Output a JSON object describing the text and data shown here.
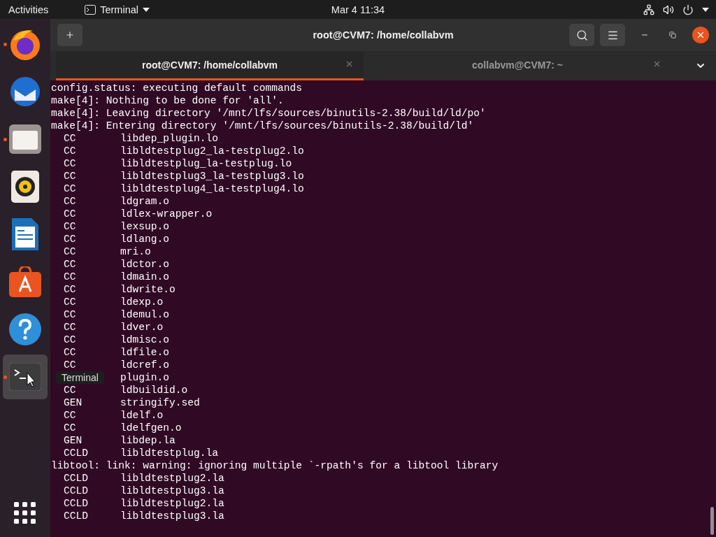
{
  "top_bar": {
    "activities": "Activities",
    "app_menu": "Terminal",
    "clock": "Mar 4  11:34"
  },
  "dock": {
    "items": [
      {
        "kind": "firefox",
        "running": true,
        "selected": false
      },
      {
        "kind": "mail",
        "running": false,
        "selected": false
      },
      {
        "kind": "files",
        "running": true,
        "selected": false
      },
      {
        "kind": "speaker",
        "running": false,
        "selected": false
      },
      {
        "kind": "document",
        "running": false,
        "selected": false
      },
      {
        "kind": "store",
        "running": false,
        "selected": false
      },
      {
        "kind": "help",
        "running": false,
        "selected": false
      },
      {
        "kind": "terminal",
        "running": true,
        "selected": true
      }
    ],
    "tooltip": "Terminal"
  },
  "window": {
    "title": "root@CVM7: /home/collabvm"
  },
  "tabs": [
    {
      "label": "root@CVM7: /home/collabvm",
      "selected": true
    },
    {
      "label": "collabvm@CVM7: ~",
      "selected": false
    }
  ],
  "terminal": {
    "lines": [
      {
        "kind": "plain",
        "text": "config.status: executing default commands"
      },
      {
        "kind": "plain",
        "text": "make[4]: Nothing to be done for 'all'."
      },
      {
        "kind": "plain",
        "text": "make[4]: Leaving directory '/mnt/lfs/sources/binutils-2.38/build/ld/po'"
      },
      {
        "kind": "plain",
        "text": "make[4]: Entering directory '/mnt/lfs/sources/binutils-2.38/build/ld'"
      },
      {
        "kind": "build",
        "tag": "CC",
        "file": "libdep_plugin.lo"
      },
      {
        "kind": "build",
        "tag": "CC",
        "file": "libldtestplug2_la-testplug2.lo"
      },
      {
        "kind": "build",
        "tag": "CC",
        "file": "libldtestplug_la-testplug.lo"
      },
      {
        "kind": "build",
        "tag": "CC",
        "file": "libldtestplug3_la-testplug3.lo"
      },
      {
        "kind": "build",
        "tag": "CC",
        "file": "libldtestplug4_la-testplug4.lo"
      },
      {
        "kind": "build",
        "tag": "CC",
        "file": "ldgram.o"
      },
      {
        "kind": "build",
        "tag": "CC",
        "file": "ldlex-wrapper.o"
      },
      {
        "kind": "build",
        "tag": "CC",
        "file": "lexsup.o"
      },
      {
        "kind": "build",
        "tag": "CC",
        "file": "ldlang.o"
      },
      {
        "kind": "build",
        "tag": "CC",
        "file": "mri.o"
      },
      {
        "kind": "build",
        "tag": "CC",
        "file": "ldctor.o"
      },
      {
        "kind": "build",
        "tag": "CC",
        "file": "ldmain.o"
      },
      {
        "kind": "build",
        "tag": "CC",
        "file": "ldwrite.o"
      },
      {
        "kind": "build",
        "tag": "CC",
        "file": "ldexp.o"
      },
      {
        "kind": "build",
        "tag": "CC",
        "file": "ldemul.o"
      },
      {
        "kind": "build",
        "tag": "CC",
        "file": "ldver.o"
      },
      {
        "kind": "build",
        "tag": "CC",
        "file": "ldmisc.o"
      },
      {
        "kind": "build",
        "tag": "CC",
        "file": "ldfile.o"
      },
      {
        "kind": "build",
        "tag": "CC",
        "file": "ldcref.o"
      },
      {
        "kind": "build",
        "file": "plugin.o"
      },
      {
        "kind": "build",
        "tag": "CC",
        "file": "ldbuildid.o"
      },
      {
        "kind": "build",
        "tag": "GEN",
        "file": "stringify.sed"
      },
      {
        "kind": "build",
        "tag": "CC",
        "file": "ldelf.o"
      },
      {
        "kind": "build",
        "tag": "CC",
        "file": "ldelfgen.o"
      },
      {
        "kind": "build",
        "tag": "GEN",
        "file": "libdep.la"
      },
      {
        "kind": "build",
        "tag": "CCLD",
        "file": "libldtestplug.la"
      },
      {
        "kind": "plain",
        "text": "libtool: link: warning: ignoring multiple `-rpath's for a libtool library"
      },
      {
        "kind": "build",
        "tag": "CCLD",
        "file": "libldtestplug2.la"
      },
      {
        "kind": "build",
        "tag": "CCLD",
        "file": "libldtestplug3.la"
      },
      {
        "kind": "build",
        "tag": "CCLD",
        "file": "libldtestplug2.la"
      },
      {
        "kind": "build",
        "tag": "CCLD",
        "file": "libldtestplug3.la"
      }
    ]
  }
}
